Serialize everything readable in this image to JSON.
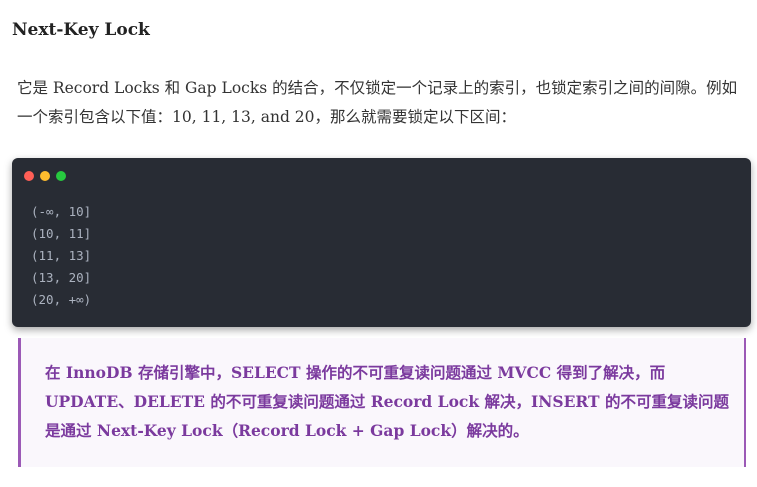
{
  "heading": "Next-Key Lock",
  "paragraph": "它是 Record Locks 和 Gap Locks 的结合，不仅锁定一个记录上的索引，也锁定索引之间的间隙。例如一个索引包含以下值：10, 11, 13, and 20，那么就需要锁定以下区间：",
  "code": {
    "window_dots": [
      {
        "name": "close",
        "color": "#ff5f56"
      },
      {
        "name": "minimize",
        "color": "#ffbd2e"
      },
      {
        "name": "maximize",
        "color": "#27c93f"
      }
    ],
    "lines": [
      "(-∞, 10]",
      "(10, 11]",
      "(11, 13]",
      "(13, 20]",
      "(20, +∞)"
    ]
  },
  "quote": "在 InnoDB 存储引擎中，SELECT 操作的不可重复读问题通过 MVCC 得到了解决，而 UPDATE、DELETE 的不可重复读问题通过 Record Lock 解决，INSERT 的不可重复读问题是通过 Next-Key Lock（Record Lock + Gap Lock）解决的。"
}
